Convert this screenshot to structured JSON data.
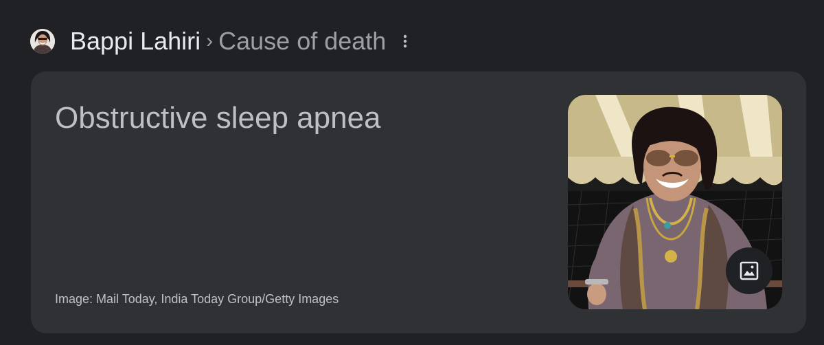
{
  "breadcrumb": {
    "entity": "Bappi Lahiri",
    "separator": "›",
    "attribute": "Cause of death"
  },
  "answer": {
    "text": "Obstructive sleep apnea",
    "image_credit": "Image: Mail Today, India Today Group/Getty Images"
  },
  "icons": {
    "more": "more-vert-icon",
    "image": "image-icon"
  },
  "colors": {
    "page_background": "#202124",
    "card_background": "#303134",
    "primary_text": "#e8eaed",
    "secondary_text": "#9aa0a6"
  }
}
